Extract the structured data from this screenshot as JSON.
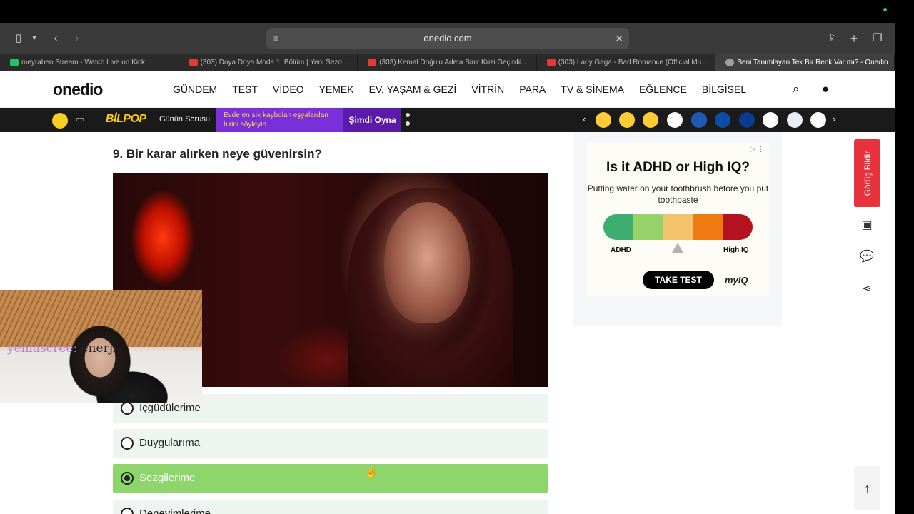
{
  "browser": {
    "url": "onedio.com",
    "tabs": [
      {
        "title": "meyraben Stream - Watch Live on Kick",
        "color": "#22c55e",
        "active": false
      },
      {
        "title": "(303) Doya Doya Moda 1. Bölüm | Yeni Sezon...",
        "color": "#e53935",
        "active": false
      },
      {
        "title": "(303) Kemal Doğulu Adeta Sinir Krizi Geçirdil...",
        "color": "#e53935",
        "active": false
      },
      {
        "title": "(303) Lady Gaga - Bad Romance (Official Mu...",
        "color": "#e53935",
        "active": false
      },
      {
        "title": "Seni Tanımlayan Tek Bir Renk Var mı? - Onedio",
        "color": "#9e9e9e",
        "active": true
      }
    ]
  },
  "site": {
    "logo": "onedio",
    "menu": [
      "GÜNDEM",
      "TEST",
      "VİDEO",
      "YEMEK",
      "EV, YAŞAM & GEZİ",
      "VİTRİN",
      "PARA",
      "TV & SİNEMA",
      "EĞLENCE",
      "BİLGİSEL"
    ]
  },
  "strip": {
    "brand": "BİLPOP",
    "question_label": "Günün Sorusu",
    "promo": "Evde en sık kaybolan eşyalardan birini söyleyin.",
    "play": "Şimdi Oyna"
  },
  "quiz": {
    "question": "9. Bir karar alırken neye güvenirsin?",
    "options": [
      {
        "label": "İçgüdülerime",
        "selected": false
      },
      {
        "label": "Duygularıma",
        "selected": false
      },
      {
        "label": "Sezgilerime",
        "selected": true
      },
      {
        "label": "Deneyimlerime",
        "selected": false
      }
    ]
  },
  "ad": {
    "headline": "Is it ADHD or High IQ?",
    "sub": "Putting water on your toothbrush before you put toothpaste",
    "left_label": "ADHD",
    "right_label": "High IQ",
    "cta": "TAKE TEST",
    "brand": "myIQ",
    "scale_colors": [
      "#3dae6e",
      "#97d26a",
      "#f2c36b",
      "#f07a12",
      "#b3121e"
    ]
  },
  "sidebar": {
    "feedback": "Görüş Bildir"
  },
  "stream": {
    "chat_user": "yemascree:",
    "chat_message": "enerji"
  }
}
